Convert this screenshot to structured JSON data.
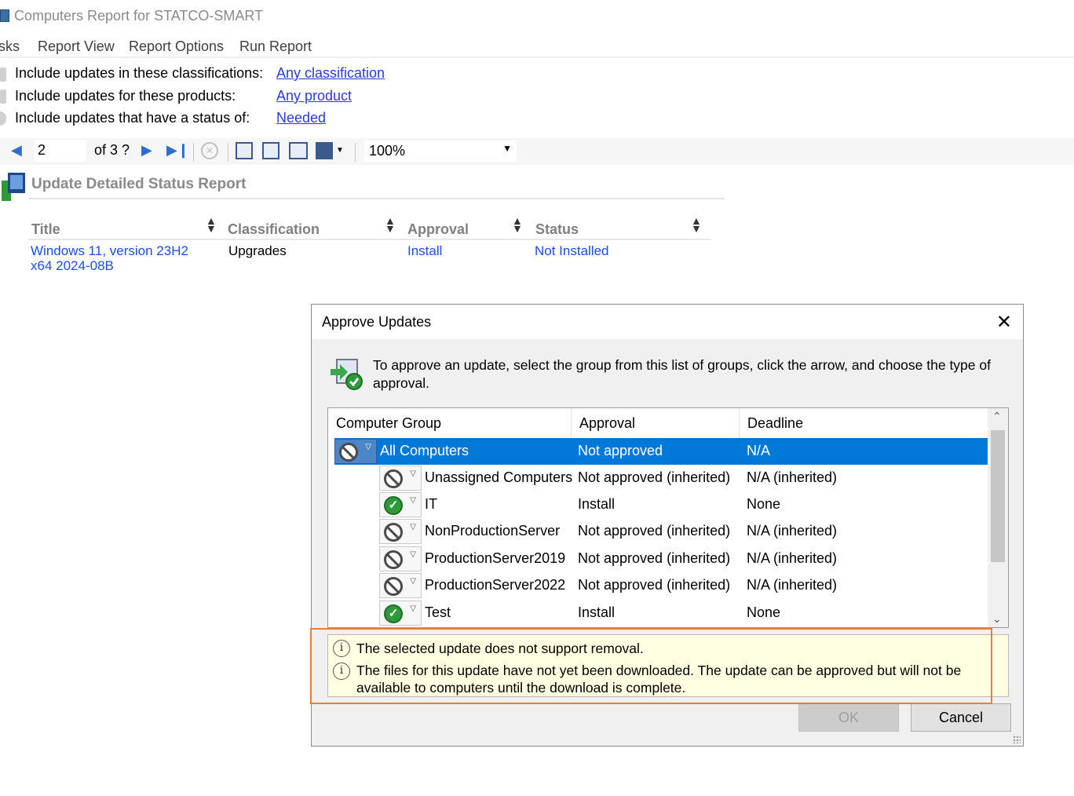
{
  "window": {
    "title": "Computers Report for STATCO-SMART"
  },
  "menu": {
    "items": [
      "sks",
      "Report View",
      "Report Options",
      "Run Report"
    ]
  },
  "criteria": [
    {
      "label": "Include updates in these classifications:",
      "value": "Any classification"
    },
    {
      "label": "Include updates for these products:",
      "value": "Any product"
    },
    {
      "label": "Include updates that have a status of:",
      "value": "Needed"
    }
  ],
  "toolbar": {
    "page": "2",
    "of_label": "of 3 ?",
    "zoom": "100%"
  },
  "report": {
    "title": "Update Detailed Status Report",
    "columns": [
      "Title",
      "Classification",
      "Approval",
      "Status"
    ],
    "row": {
      "title": "Windows 11, version 23H2 x64 2024-08B",
      "classification": "Upgrades",
      "approval": "Install",
      "status": "Not Installed"
    }
  },
  "dialog": {
    "title": "Approve Updates",
    "instructions": "To approve an update, select the group from this list of groups, click the arrow, and choose the type of approval.",
    "columns": [
      "Computer Group",
      "Approval",
      "Deadline"
    ],
    "rows": [
      {
        "group": "All Computers",
        "approval": "Not approved",
        "deadline": "N/A",
        "icon": "block-icon"
      },
      {
        "group": "Unassigned Computers",
        "approval": "Not approved (inherited)",
        "deadline": "N/A (inherited)",
        "icon": "block-icon"
      },
      {
        "group": "IT",
        "approval": "Install",
        "deadline": "None",
        "icon": "check-icon"
      },
      {
        "group": "NonProductionServer",
        "approval": "Not approved (inherited)",
        "deadline": "N/A (inherited)",
        "icon": "block-icon"
      },
      {
        "group": "ProductionServer2019",
        "approval": "Not approved (inherited)",
        "deadline": "N/A (inherited)",
        "icon": "block-icon"
      },
      {
        "group": "ProductionServer2022",
        "approval": "Not approved (inherited)",
        "deadline": "N/A (inherited)",
        "icon": "block-icon"
      },
      {
        "group": "Test",
        "approval": "Install",
        "deadline": "None",
        "icon": "check-icon"
      }
    ],
    "messages": [
      "The selected update does not support removal.",
      "The files for this update have not yet been downloaded. The update can be approved but will not be available to computers until the download is complete."
    ],
    "buttons": {
      "ok": "OK",
      "cancel": "Cancel"
    }
  },
  "colors": {
    "link": "#2a3cd6",
    "selection": "#0078d7",
    "highlight": "#ed7d31",
    "info_bg": "#ffffe1"
  }
}
